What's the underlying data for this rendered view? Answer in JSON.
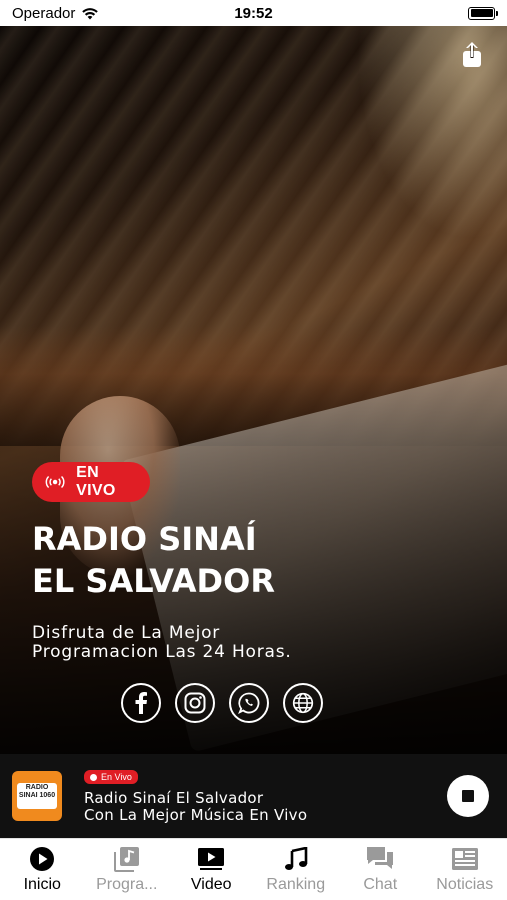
{
  "status_bar": {
    "carrier": "Operador",
    "time": "19:52",
    "icons": [
      "wifi-icon",
      "battery-icon"
    ]
  },
  "hero": {
    "share_icon": "share-icon",
    "live_badge": "EN VIVO",
    "title_line1": "RADIO SINAÍ",
    "title_line2": "EL SALVADOR",
    "subtitle_line1": "Disfruta de La Mejor",
    "subtitle_line2": "Programacion Las 24 Horas.",
    "socials": [
      "facebook-icon",
      "instagram-icon",
      "whatsapp-icon",
      "globe-icon"
    ]
  },
  "player": {
    "logo_text": "RADIO SINAI 1060",
    "live_badge": "En Vivo",
    "line1": "Radio Sinaí El Salvador",
    "line2": "Con La Mejor Música En Vivo",
    "control": "stop-icon"
  },
  "tabs": [
    {
      "label": "Inicio",
      "icon": "play-circle-icon",
      "active": true
    },
    {
      "label": "Progra...",
      "icon": "music-list-icon",
      "active": false
    },
    {
      "label": "Video",
      "icon": "video-play-icon",
      "active": true
    },
    {
      "label": "Ranking",
      "icon": "music-note-icon",
      "active": true
    },
    {
      "label": "Chat",
      "icon": "chat-icon",
      "active": false
    },
    {
      "label": "Noticias",
      "icon": "newspaper-icon",
      "active": false
    }
  ],
  "colors": {
    "accent_red": "#e01e25",
    "player_bg": "#111111",
    "logo_orange": "#f08a1e",
    "inactive_tab": "#9a9a9a"
  }
}
